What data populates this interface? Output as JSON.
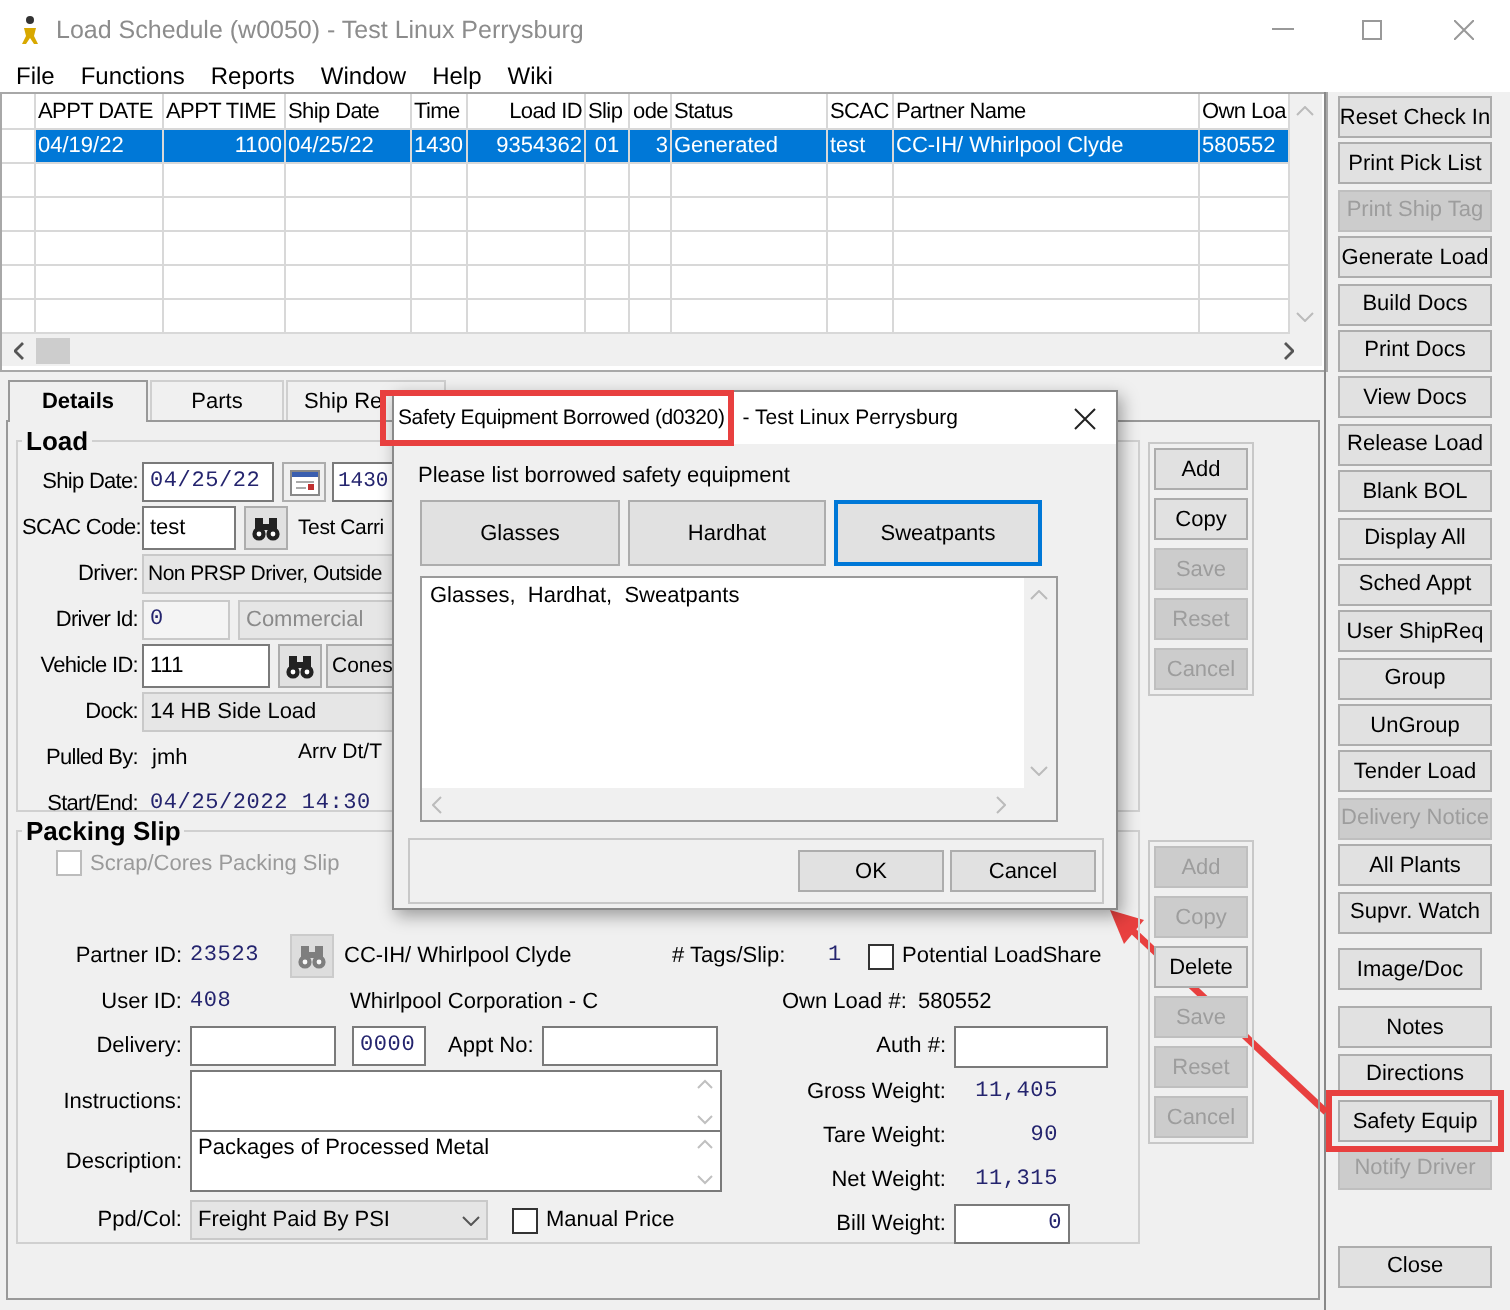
{
  "window": {
    "title": "Load Schedule (w0050) - Test Linux Perrysburg"
  },
  "menu": [
    "File",
    "Functions",
    "Reports",
    "Window",
    "Help",
    "Wiki"
  ],
  "grid": {
    "columns": [
      "APPT DATE",
      "APPT TIME",
      "Ship Date",
      "Time",
      "Load ID",
      "Slip",
      "ode",
      "Status",
      "SCAC",
      "Partner Name",
      "Own Loa"
    ],
    "rows": [
      {
        "selected": true,
        "cells": [
          "04/19/22",
          "1100",
          "04/25/22",
          "1430",
          "9354362",
          "01",
          "3",
          "Generated",
          "test",
          "CC-IH/ Whirlpool Clyde",
          "580552"
        ]
      }
    ]
  },
  "tabs": [
    {
      "label": "Details",
      "selected": true
    },
    {
      "label": "Parts",
      "selected": false
    },
    {
      "label": "Ship Re",
      "selected": false
    }
  ],
  "load": {
    "title": "Load",
    "ship_date": {
      "label": "Ship Date:",
      "value": "04/25/22",
      "time": "1430"
    },
    "scac": {
      "label": "SCAC Code:",
      "value": "test",
      "carrier": "Test Carri"
    },
    "driver": {
      "label": "Driver:",
      "value": "Non PRSP Driver, Outside"
    },
    "driver_id": {
      "label": "Driver Id:",
      "value": "0",
      "type": "Commercial"
    },
    "vehicle": {
      "label": "Vehicle ID:",
      "value": "111",
      "button": "Cones"
    },
    "dock": {
      "label": "Dock:",
      "value": "14 HB Side Load"
    },
    "pulled_by": {
      "label": "Pulled By:",
      "value": "jmh",
      "arrival_label": "Arrv Dt/T"
    },
    "start_end": {
      "label": "Start/End:",
      "value": "04/25/2022 14:30"
    }
  },
  "load_actions": [
    {
      "label": "Add",
      "disabled": false
    },
    {
      "label": "Copy",
      "disabled": false
    },
    {
      "label": "Save",
      "disabled": true
    },
    {
      "label": "Reset",
      "disabled": true
    },
    {
      "label": "Cancel",
      "disabled": true
    }
  ],
  "packing_slip": {
    "title": "Packing Slip",
    "scrap_cores": {
      "label": "Scrap/Cores Packing Slip",
      "checked": false,
      "disabled": true
    },
    "partner_id": {
      "label": "Partner ID:",
      "value": "23523",
      "name": "CC-IH/ Whirlpool Clyde"
    },
    "tags": {
      "label": "# Tags/Slip:",
      "value": "1"
    },
    "potential_loadshare": {
      "label": "Potential LoadShare",
      "checked": false
    },
    "user_id": {
      "label": "User ID:",
      "value": "408",
      "company": "Whirlpool Corporation - C"
    },
    "own_load": {
      "label": "Own Load #:",
      "value": "580552"
    },
    "delivery": {
      "label": "Delivery:",
      "time": "0000",
      "appt_label": "Appt No:"
    },
    "auth": {
      "label": "Auth #:"
    },
    "instructions": {
      "label": "Instructions:"
    },
    "description": {
      "label": "Description:",
      "value": "Packages of Processed Metal"
    },
    "ppd_col": {
      "label": "Ppd/Col:",
      "value": "Freight Paid By PSI"
    },
    "manual_price": {
      "label": "Manual Price",
      "checked": false
    },
    "weights": [
      {
        "label": "Gross Weight:",
        "value": "11,405"
      },
      {
        "label": "Tare Weight:",
        "value": "90"
      },
      {
        "label": "Net Weight:",
        "value": "11,315"
      }
    ],
    "bill_weight": {
      "label": "Bill Weight:",
      "value": "0"
    }
  },
  "packing_actions": [
    {
      "label": "Add",
      "disabled": true
    },
    {
      "label": "Copy",
      "disabled": true
    },
    {
      "label": "Delete",
      "disabled": false
    },
    {
      "label": "Save",
      "disabled": true
    },
    {
      "label": "Reset",
      "disabled": true
    },
    {
      "label": "Cancel",
      "disabled": true
    }
  ],
  "side_buttons": [
    {
      "label": "Reset Check In",
      "disabled": false,
      "highlighted": false
    },
    {
      "label": "Print Pick List",
      "disabled": false,
      "highlighted": false
    },
    {
      "label": "Print Ship Tag",
      "disabled": true,
      "highlighted": false
    },
    {
      "label": "Generate Load",
      "disabled": false,
      "highlighted": false
    },
    {
      "label": "Build Docs",
      "disabled": false,
      "highlighted": false
    },
    {
      "label": "Print Docs",
      "disabled": false,
      "highlighted": false
    },
    {
      "label": "View Docs",
      "disabled": false,
      "highlighted": false
    },
    {
      "label": "Release Load",
      "disabled": false,
      "highlighted": false
    },
    {
      "label": "Blank BOL",
      "disabled": false,
      "highlighted": false
    },
    {
      "label": "Display All",
      "disabled": false,
      "highlighted": false
    },
    {
      "label": "Sched Appt",
      "disabled": false,
      "highlighted": false
    },
    {
      "label": "User ShipReq",
      "disabled": false,
      "highlighted": false
    },
    {
      "label": "Group",
      "disabled": false,
      "highlighted": false
    },
    {
      "label": "UnGroup",
      "disabled": false,
      "highlighted": false
    },
    {
      "label": "Tender Load",
      "disabled": false,
      "highlighted": false
    },
    {
      "label": "Delivery Notice",
      "disabled": true,
      "highlighted": false
    },
    {
      "label": "All Plants",
      "disabled": false,
      "highlighted": false
    },
    {
      "label": "Supvr. Watch",
      "disabled": false,
      "highlighted": false
    },
    {
      "label": "Image/Doc",
      "disabled": false,
      "highlighted": false
    },
    {
      "label": "Notes",
      "disabled": false,
      "highlighted": false
    },
    {
      "label": "Directions",
      "disabled": false,
      "highlighted": false
    },
    {
      "label": "Safety Equip",
      "disabled": false,
      "highlighted": true
    },
    {
      "label": "Notify Driver",
      "disabled": true,
      "highlighted": false
    },
    {
      "label": "Close",
      "disabled": false,
      "highlighted": false
    }
  ],
  "dialog": {
    "title": "Safety Equipment Borrowed (d0320)",
    "title_suffix": "- Test Linux Perrysburg",
    "title_highlighted": true,
    "prompt": "Please list borrowed safety equipment",
    "options": [
      {
        "label": "Glasses",
        "focused": false
      },
      {
        "label": "Hardhat",
        "focused": false
      },
      {
        "label": "Sweatpants",
        "focused": true
      }
    ],
    "list_text": "Glasses,  Hardhat,  Sweatpants",
    "buttons": [
      "OK",
      "Cancel"
    ]
  }
}
